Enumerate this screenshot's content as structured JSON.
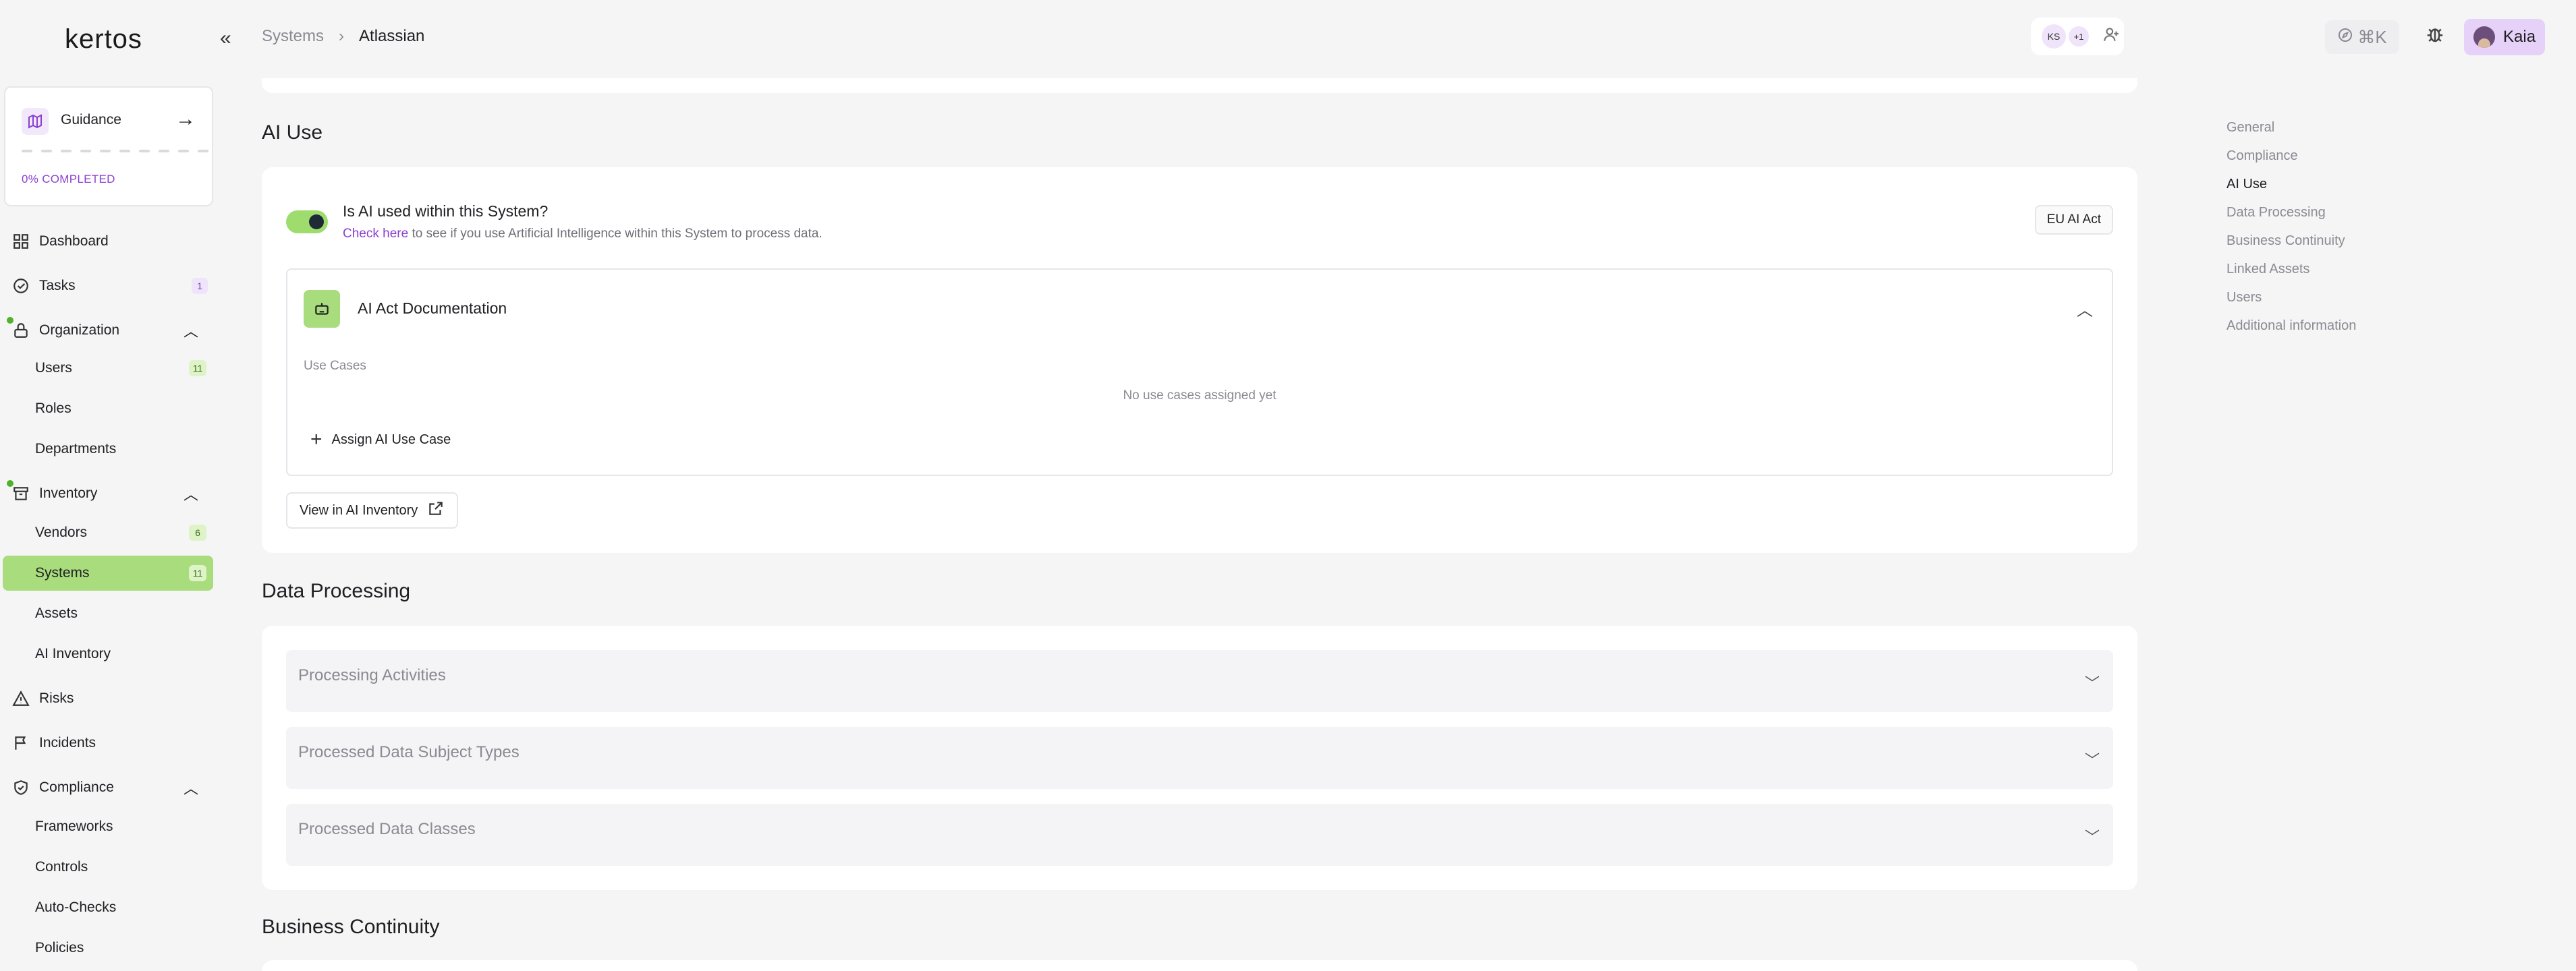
{
  "brand": {
    "logo": "kertos"
  },
  "sidebar": {
    "guidance": {
      "label": "Guidance",
      "progress_text": "0% COMPLETED",
      "progress": 0
    },
    "nav": {
      "dashboard": "Dashboard",
      "tasks": "Tasks",
      "tasks_count": "1",
      "organization": "Organization",
      "users": "Users",
      "users_count": "11",
      "roles": "Roles",
      "departments": "Departments",
      "inventory": "Inventory",
      "vendors": "Vendors",
      "vendors_count": "6",
      "systems": "Systems",
      "systems_count": "11",
      "assets": "Assets",
      "ai_inventory": "AI Inventory",
      "risks": "Risks",
      "incidents": "Incidents",
      "compliance": "Compliance",
      "frameworks": "Frameworks",
      "controls": "Controls",
      "auto_checks": "Auto-Checks",
      "policies": "Policies"
    }
  },
  "header": {
    "breadcrumb": [
      "Systems",
      "Atlassian"
    ],
    "collaborators": {
      "initials": "KS",
      "more": "+1"
    },
    "shortcut": "⌘K",
    "user": "Kaia"
  },
  "ai_use": {
    "title": "AI Use",
    "question": "Is AI used within this System?",
    "help_link": "Check here",
    "help_text": " to see if you use Artificial Intelligence within this System to process data.",
    "tag": "EU AI Act",
    "enabled": true,
    "doc_title": "AI Act Documentation",
    "use_cases_label": "Use Cases",
    "use_cases_empty": "No use cases assigned yet",
    "assign_label": "Assign AI Use Case",
    "view_label": "View in AI Inventory"
  },
  "data_processing": {
    "title": "Data Processing",
    "rows": [
      "Processing Activities",
      "Processed Data Subject Types",
      "Processed Data Classes"
    ]
  },
  "business_continuity": {
    "title": "Business Continuity"
  },
  "toc": {
    "items": [
      "General",
      "Compliance",
      "AI Use",
      "Data Processing",
      "Business Continuity",
      "Linked Assets",
      "Users",
      "Additional information"
    ],
    "active": "AI Use"
  },
  "colors": {
    "accent_green": "#a8dc7c",
    "accent_purple": "#8b3fd0"
  }
}
